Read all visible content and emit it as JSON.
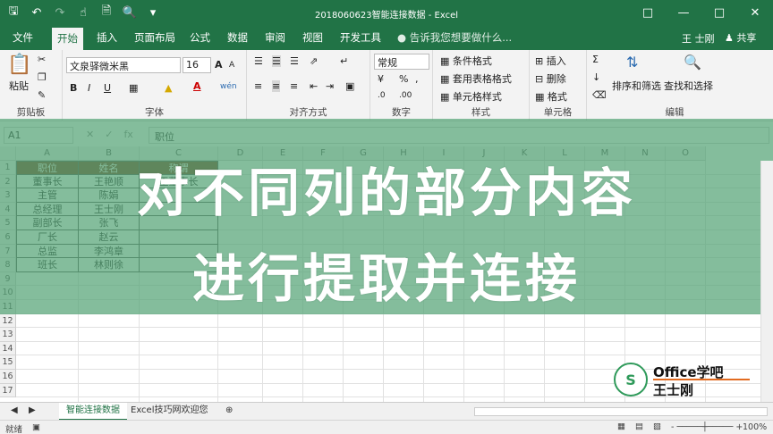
{
  "window": {
    "title": "2018060623智能连接数据 - Excel"
  },
  "qat": {
    "save_icon": "save-icon",
    "undo_icon": "undo-icon",
    "redo_icon": "redo-icon"
  },
  "tabs": [
    "文件",
    "开始",
    "插入",
    "页面布局",
    "公式",
    "数据",
    "审阅",
    "视图",
    "开发工具"
  ],
  "active_tab": "开始",
  "tell_me": "告诉我您想要做什么...",
  "user": "王 士刚",
  "share": "共享",
  "ribbon": {
    "clipboard": {
      "label": "剪贴板",
      "paste": "粘贴"
    },
    "font": {
      "label": "字体",
      "name": "文泉驿微米黑",
      "size": "16",
      "bold": "B",
      "italic": "I",
      "underline": "U",
      "font_color": "A",
      "grow": "A",
      "shrink": "A",
      "phonetic": "wén"
    },
    "alignment": {
      "label": "对齐方式"
    },
    "number": {
      "label": "数字",
      "format": "常规"
    },
    "styles": {
      "label": "样式",
      "conditional": "条件格式",
      "table": "套用表格格式",
      "cell_styles": "单元格样式"
    },
    "cells": {
      "label": "单元格",
      "insert": "插入",
      "delete": "删除",
      "format": "格式"
    },
    "editing": {
      "label": "编辑",
      "sort": "排序和筛选",
      "find": "查找和选择"
    }
  },
  "formula_bar": {
    "name_box": "A1",
    "content": "职位"
  },
  "columns": [
    "A",
    "B",
    "C",
    "D",
    "E",
    "F",
    "G",
    "H",
    "I",
    "J",
    "K",
    "L",
    "M",
    "N",
    "O"
  ],
  "rows": [
    "1",
    "2",
    "3",
    "4",
    "5",
    "6",
    "7",
    "8",
    "9",
    "10",
    "11",
    "12",
    "13",
    "14",
    "15",
    "16",
    "17"
  ],
  "table": {
    "headers": [
      "职位",
      "姓名",
      "称谓"
    ],
    "rows": [
      [
        "董事长",
        "王艳顺",
        "王董事长"
      ],
      [
        "主管",
        "陈娟",
        ""
      ],
      [
        "总经理",
        "王士刚",
        ""
      ],
      [
        "副部长",
        "张飞",
        ""
      ],
      [
        "厂长",
        "赵云",
        ""
      ],
      [
        "总监",
        "李鸿章",
        ""
      ],
      [
        "班长",
        "林则徐",
        ""
      ]
    ]
  },
  "overlay": {
    "line1": "对不同列的部分内容",
    "line2": "进行提取并连接"
  },
  "logo": {
    "line1": "Office学吧",
    "line2": "王士刚"
  },
  "sheets": [
    "智能连接数据",
    "Excel技巧网欢迎您"
  ],
  "active_sheet": "智能连接数据",
  "status": {
    "ready": "就绪",
    "zoom": "100%"
  }
}
